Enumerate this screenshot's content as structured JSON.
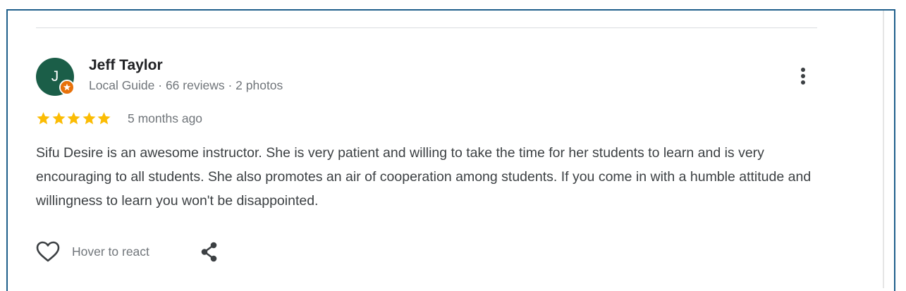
{
  "review": {
    "author": {
      "initial": "J",
      "name": "Jeff Taylor",
      "meta": "Local Guide · 66 reviews · 2 photos",
      "avatar_color": "#1b5e48",
      "badge_color": "#e8710a"
    },
    "rating": 5,
    "rating_max": 5,
    "star_color": "#fbbc04",
    "date": "5 months ago",
    "text": "Sifu Desire is an awesome instructor. She is very patient and willing to take the time for her students to learn and is very encouraging to all students. She also promotes an air of cooperation among students. If you come in with a humble attitude and willingness to learn you won't be disappointed.",
    "actions": {
      "react_label": "Hover to react",
      "react_icon": "heart-icon",
      "share_icon": "share-icon",
      "more_icon": "more-vert-icon"
    }
  }
}
